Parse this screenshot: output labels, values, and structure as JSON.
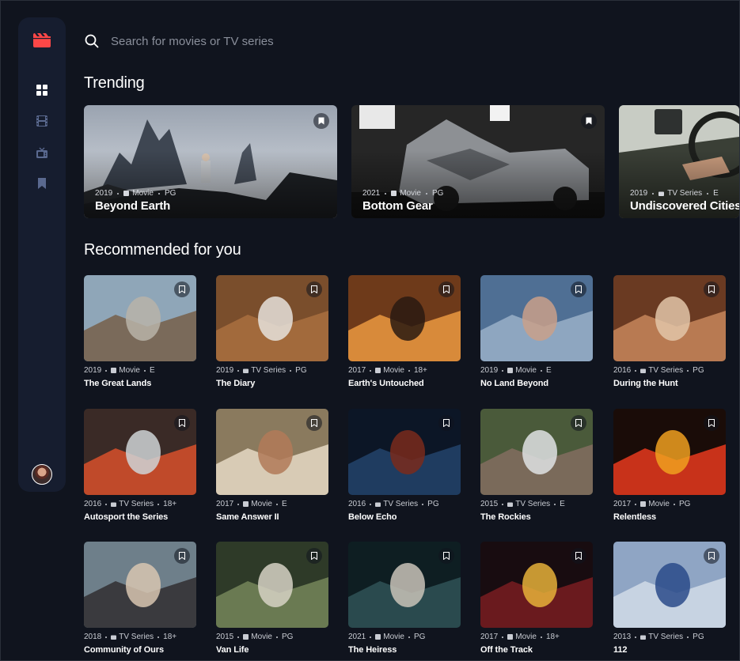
{
  "search": {
    "placeholder": "Search for movies or TV series"
  },
  "sidebar": {
    "items": [
      {
        "name": "home",
        "icon": "grid-icon",
        "active": true
      },
      {
        "name": "movies",
        "icon": "film-icon",
        "active": false
      },
      {
        "name": "tv-series",
        "icon": "tv-icon",
        "active": false
      },
      {
        "name": "bookmarks",
        "icon": "bookmark-icon",
        "active": false
      }
    ]
  },
  "colors": {
    "background": "#10141e",
    "sidebar": "#161d2f",
    "accent": "#fc4747",
    "muted": "#5a698f"
  },
  "trending": {
    "title": "Trending",
    "items": [
      {
        "year": "2019",
        "category": "Movie",
        "rating": "PG",
        "title": "Beyond Earth"
      },
      {
        "year": "2021",
        "category": "Movie",
        "rating": "PG",
        "title": "Bottom Gear"
      },
      {
        "year": "2019",
        "category": "TV Series",
        "rating": "E",
        "title": "Undiscovered Cities"
      }
    ]
  },
  "recommended": {
    "title": "Recommended for you",
    "items": [
      {
        "year": "2019",
        "category": "Movie",
        "rating": "E",
        "title": "The Great Lands"
      },
      {
        "year": "2019",
        "category": "TV Series",
        "rating": "PG",
        "title": "The Diary"
      },
      {
        "year": "2017",
        "category": "Movie",
        "rating": "18+",
        "title": "Earth's Untouched"
      },
      {
        "year": "2019",
        "category": "Movie",
        "rating": "E",
        "title": "No Land Beyond"
      },
      {
        "year": "2016",
        "category": "TV Series",
        "rating": "PG",
        "title": "During the Hunt"
      },
      {
        "year": "2016",
        "category": "TV Series",
        "rating": "18+",
        "title": "Autosport the Series"
      },
      {
        "year": "2017",
        "category": "Movie",
        "rating": "E",
        "title": "Same Answer II"
      },
      {
        "year": "2016",
        "category": "TV Series",
        "rating": "PG",
        "title": "Below Echo"
      },
      {
        "year": "2015",
        "category": "TV Series",
        "rating": "E",
        "title": "The Rockies"
      },
      {
        "year": "2017",
        "category": "Movie",
        "rating": "PG",
        "title": "Relentless"
      },
      {
        "year": "2018",
        "category": "TV Series",
        "rating": "18+",
        "title": "Community of Ours"
      },
      {
        "year": "2015",
        "category": "Movie",
        "rating": "PG",
        "title": "Van Life"
      },
      {
        "year": "2021",
        "category": "Movie",
        "rating": "PG",
        "title": "The Heiress"
      },
      {
        "year": "2017",
        "category": "Movie",
        "rating": "18+",
        "title": "Off the Track"
      },
      {
        "year": "2013",
        "category": "TV Series",
        "rating": "PG",
        "title": "112"
      }
    ]
  }
}
